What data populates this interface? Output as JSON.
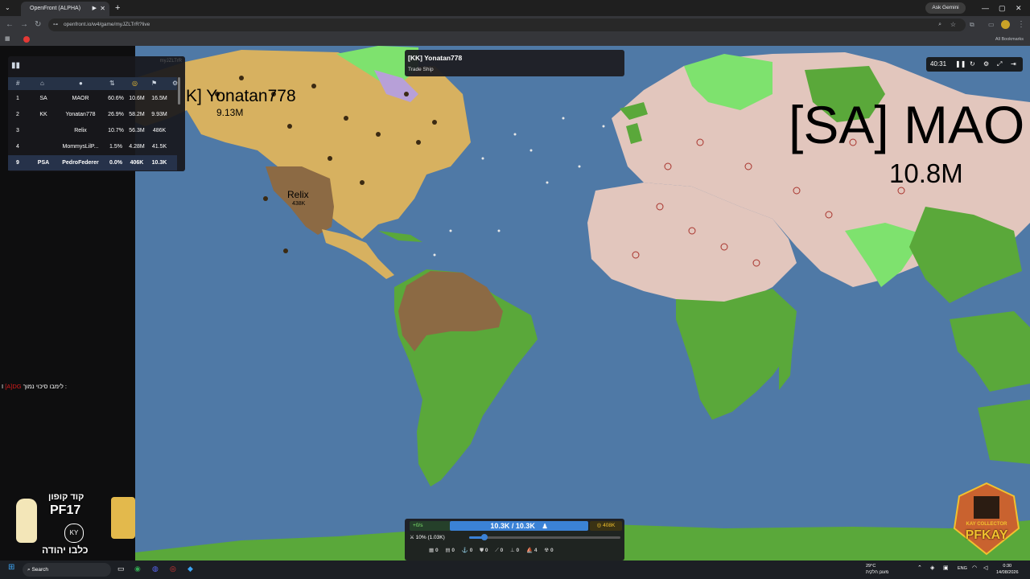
{
  "browser": {
    "tab_title": "OpenFront (ALPHA)",
    "url": "openfront.io/w4/game/myJZLTrR?live",
    "gemini_label": "Ask Gemini",
    "bookmarks_label": "All Bookmarks"
  },
  "leaderboard": {
    "watermark": "myJZLTrR",
    "headers": [
      "#",
      "",
      "",
      "",
      "",
      "",
      ""
    ],
    "rows": [
      {
        "rank": "1",
        "tag": "SA",
        "name": "MAOR",
        "owned": "60.6%",
        "gold": "10.6M",
        "troops": "16.5M"
      },
      {
        "rank": "2",
        "tag": "KK",
        "name": "Yonatan778",
        "owned": "26.9%",
        "gold": "58.2M",
        "troops": "9.93M"
      },
      {
        "rank": "3",
        "tag": "",
        "name": "Relix",
        "owned": "10.7%",
        "gold": "56.3M",
        "troops": "486K"
      },
      {
        "rank": "4",
        "tag": "",
        "name": "MommysLilP...",
        "owned": "1.5%",
        "gold": "4.28M",
        "troops": "41.5K"
      },
      {
        "rank": "9",
        "tag": "PSA",
        "name": "PedroFederer",
        "owned": "0.0%",
        "gold": "406K",
        "troops": "10.3K"
      }
    ]
  },
  "tooltip": {
    "title": "[KK] Yonatan778",
    "subtitle": "Trade Ship"
  },
  "timer": {
    "time": "40:31"
  },
  "map_labels": {
    "yonatan_name": "K] Yonatan778",
    "yonatan_troops": "9.13M",
    "relix_name": "Relix",
    "relix_troops": "438K",
    "maor_name": "[SA] MAO",
    "maor_troops": "10.8M"
  },
  "chat": {
    "prefix": "I",
    "highlight": "[A]DG",
    "message": "לימבו סיכוי נמוך :"
  },
  "controls": {
    "rate": "+0/s",
    "troops": "10.3K / 10.3K",
    "gold": "408K",
    "ratio": "10% (1.03K)",
    "ratio_value": 0.1,
    "build_counts": [
      "0",
      "0",
      "0",
      "0",
      "0",
      "0",
      "4",
      "0"
    ]
  },
  "promo": {
    "code_line": "קוד קופון",
    "code": "PF17",
    "badge": "KY",
    "footer": "כלבו יהודה"
  },
  "logo": {
    "line1": "KAY COLLECTOR",
    "line2": "PFKAY"
  },
  "taskbar": {
    "search": "Search",
    "weather": "29°C",
    "weather_desc": "מעונן חלקית",
    "lang": "ENG",
    "time": "0:30",
    "date": "14/08/2026"
  },
  "colors": {
    "ocean": "#4f79a6",
    "land": "#5aa83a",
    "yonatan": "#d7b160",
    "relix": "#8c6a44",
    "maor": "#e2c6bd",
    "bright_green": "#7ee26e",
    "troop_bar": "#3b82d6",
    "gold": "#f2c12e"
  }
}
